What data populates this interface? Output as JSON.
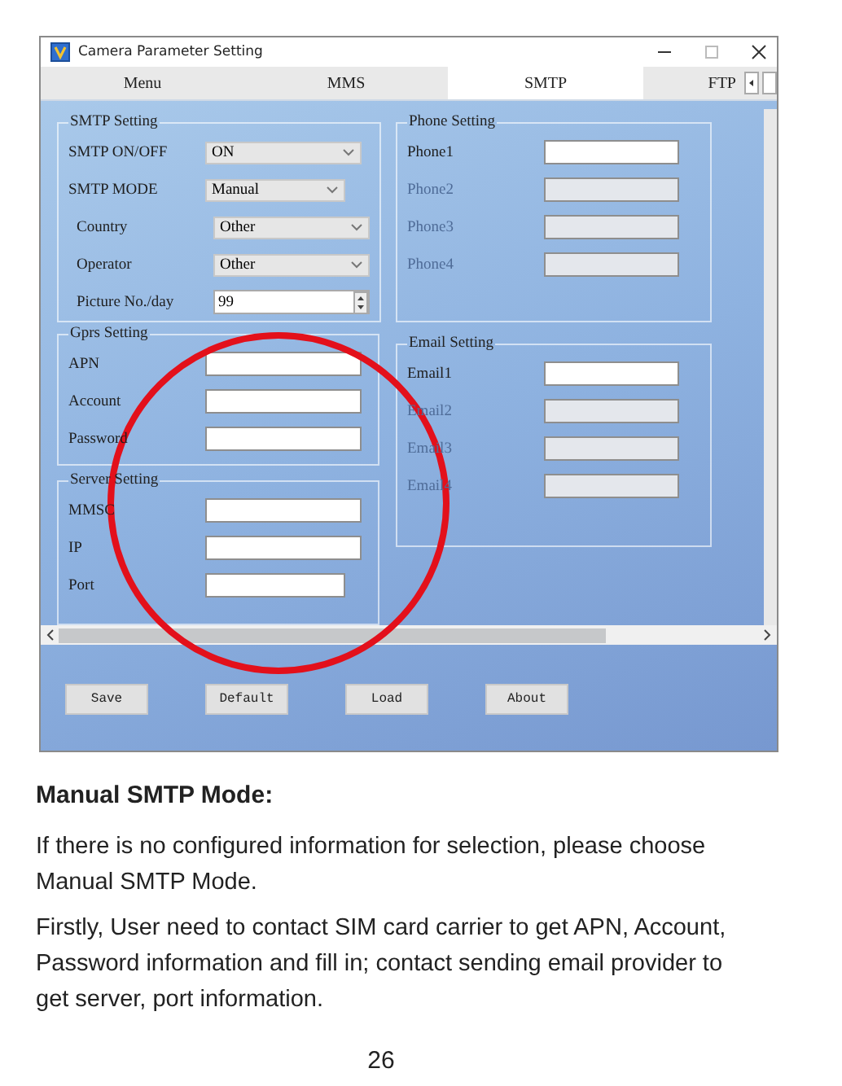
{
  "window": {
    "title": "Camera Parameter Setting"
  },
  "tabs": [
    {
      "label": "Menu",
      "selected": false
    },
    {
      "label": "MMS",
      "selected": false
    },
    {
      "label": "SMTP",
      "selected": true
    },
    {
      "label": "FTP",
      "selected": false
    }
  ],
  "smtp_setting": {
    "title": "SMTP Setting",
    "rows": [
      {
        "kind": "select",
        "label": "SMTP  ON/OFF",
        "value": "ON"
      },
      {
        "kind": "select",
        "label": "SMTP  MODE",
        "value": "Manual"
      },
      {
        "kind": "select",
        "label": "Country",
        "value": "Other"
      },
      {
        "kind": "select",
        "label": "Operator",
        "value": "Other"
      },
      {
        "kind": "spinner",
        "label": "Picture No./day",
        "value": "99"
      }
    ]
  },
  "gprs_setting": {
    "title": "Gprs Setting",
    "fields": [
      {
        "label": "APN",
        "disabled": false
      },
      {
        "label": "Account",
        "disabled": false
      },
      {
        "label": "Password",
        "disabled": false
      }
    ]
  },
  "server_setting": {
    "title": "Server Setting",
    "fields": [
      {
        "label": "MMSC",
        "disabled": false
      },
      {
        "label": "IP",
        "disabled": false
      },
      {
        "label": "Port",
        "disabled": false
      }
    ]
  },
  "phone_setting": {
    "title": "Phone Setting",
    "fields": [
      {
        "label": "Phone1",
        "disabled": false
      },
      {
        "label": "Phone2",
        "disabled": true
      },
      {
        "label": "Phone3",
        "disabled": true
      },
      {
        "label": "Phone4",
        "disabled": true
      }
    ]
  },
  "email_setting": {
    "title": "Email Setting",
    "fields": [
      {
        "label": "Email1",
        "disabled": false
      },
      {
        "label": "Email2",
        "disabled": true
      },
      {
        "label": "Email3",
        "disabled": true
      },
      {
        "label": "Email4",
        "disabled": true
      }
    ]
  },
  "buttons": [
    "Save",
    "Default",
    "Load",
    "About"
  ],
  "manual": {
    "heading": "Manual SMTP Mode:",
    "paragraphs": [
      "If there is no configured information for selection, please choose Manual SMTP Mode.",
      "Firstly, User need to contact SIM card carrier to get APN, Account, Password information and fill in; contact sending email provider to get server, port information."
    ],
    "page_number": "26"
  }
}
